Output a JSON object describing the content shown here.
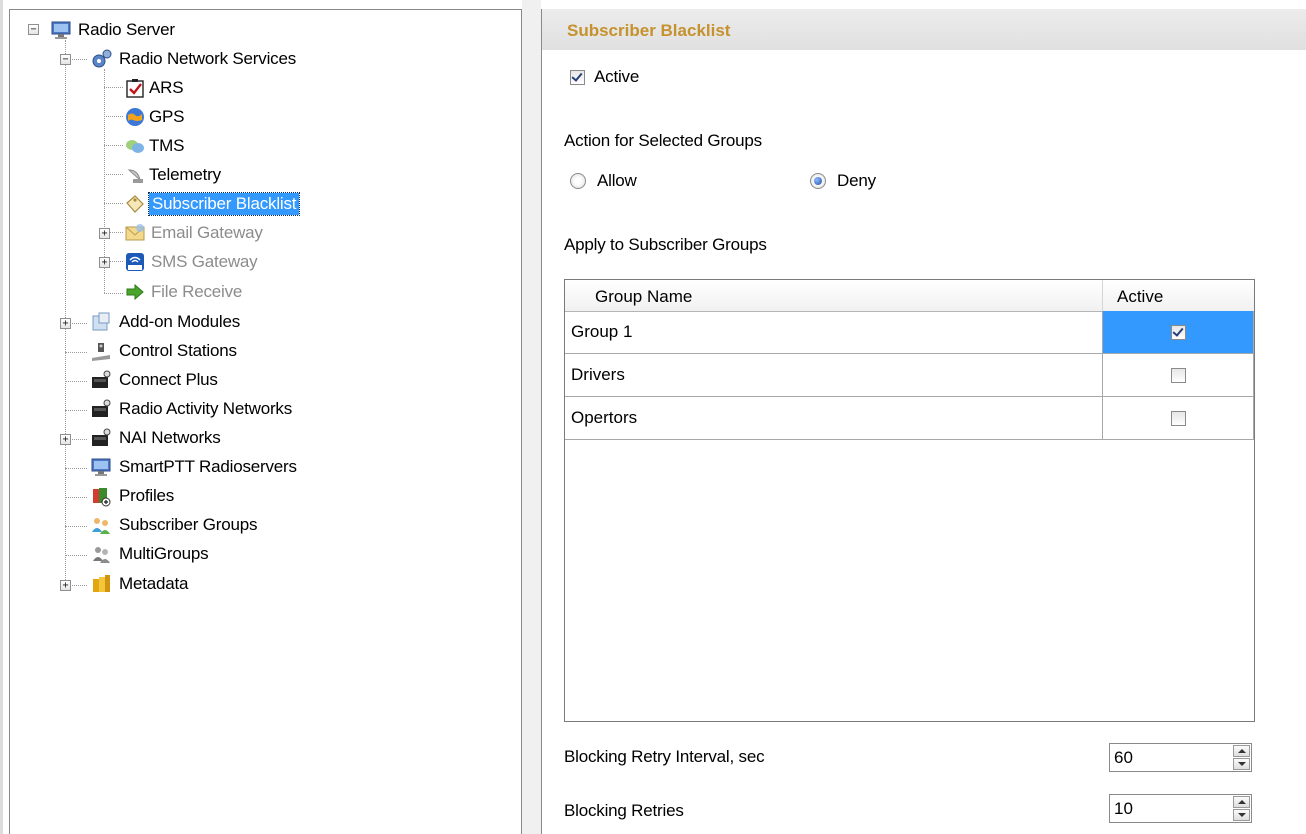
{
  "tree": {
    "root": {
      "label": "Radio Server",
      "icon": "server-icon"
    },
    "radio_network_services": {
      "label": "Radio Network Services",
      "icon": "gear-network-icon",
      "children": [
        {
          "label": "ARS",
          "icon": "checklist-icon"
        },
        {
          "label": "GPS",
          "icon": "globe-icon"
        },
        {
          "label": "TMS",
          "icon": "chat-bubbles-icon"
        },
        {
          "label": "Telemetry",
          "icon": "satellite-dish-icon"
        },
        {
          "label": "Subscriber Blacklist",
          "icon": "tag-icon",
          "selected": true
        },
        {
          "label": "Email Gateway",
          "icon": "envelope-icon",
          "disabled": true
        },
        {
          "label": "SMS Gateway",
          "icon": "sms-icon",
          "disabled": true
        },
        {
          "label": "File Receive",
          "icon": "arrow-right-icon",
          "disabled": true
        }
      ]
    },
    "top_items": [
      {
        "label": "Add-on Modules",
        "icon": "puzzle-icon"
      },
      {
        "label": "Control Stations",
        "icon": "radio-station-icon"
      },
      {
        "label": "Connect Plus",
        "icon": "network-device-icon"
      },
      {
        "label": "Radio Activity Networks",
        "icon": "network-device-icon"
      },
      {
        "label": "NAI Networks",
        "icon": "network-device-icon"
      },
      {
        "label": "SmartPTT Radioservers",
        "icon": "server-icon"
      },
      {
        "label": "Profiles",
        "icon": "profiles-icon"
      },
      {
        "label": "Subscriber Groups",
        "icon": "users-icon"
      },
      {
        "label": "MultiGroups",
        "icon": "multi-users-icon"
      },
      {
        "label": "Metadata",
        "icon": "database-icon"
      }
    ]
  },
  "settings": {
    "title": "Subscriber Blacklist",
    "active": {
      "label": "Active",
      "checked": true
    },
    "action": {
      "heading": "Action for Selected Groups",
      "options": [
        {
          "label": "Allow",
          "checked": false
        },
        {
          "label": "Deny",
          "checked": true
        }
      ]
    },
    "groups": {
      "heading": "Apply to Subscriber Groups",
      "columns": [
        "Group Name",
        "Active"
      ],
      "rows": [
        {
          "name": "Group 1",
          "active": true,
          "selected": true
        },
        {
          "name": "Drivers",
          "active": false
        },
        {
          "name": "Opertors",
          "active": false
        }
      ]
    },
    "retry_interval": {
      "label": "Blocking Retry Interval, sec",
      "value": "60"
    },
    "retries": {
      "label": "Blocking Retries",
      "value": "10"
    }
  },
  "colors": {
    "title": "#c5922d",
    "selection": "#3399ff",
    "disabled_text": "#8c8c8c"
  }
}
